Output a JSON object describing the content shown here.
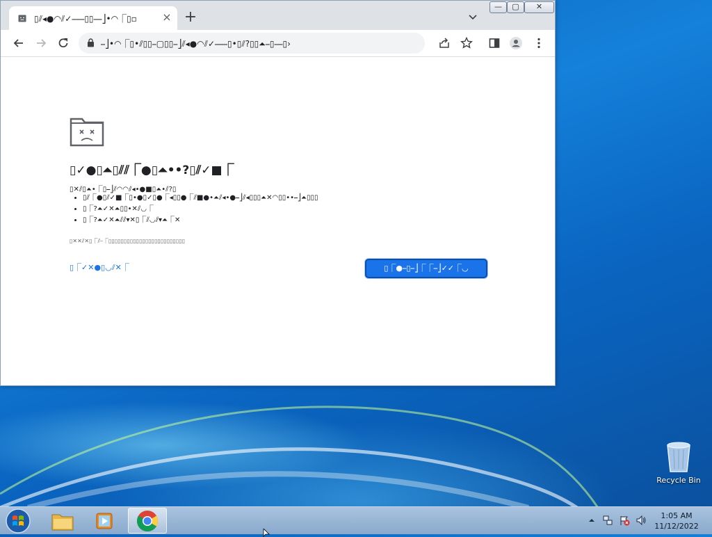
{
  "browser": {
    "tab": {
      "title": "▯⫽◂●◠⫽✓⎯⎯⎯▯▯⎯⎯⎦•◠⎾▯▫",
      "close_label": "×"
    },
    "new_tab_label": "+",
    "caption": {
      "minimize": "—",
      "maximize": "▢",
      "close": "✕"
    },
    "toolbar": {
      "url": "⎯⎦•◠⎾▯•⫽▯▯⎯▢▯▯⎯⎦⫽◂●◠⫽✓⎯⎯⎯▯•▯⫽?▯▯⏶⎯▯⎯⎯▯›"
    },
    "error_page": {
      "heading": "▯✓●▯⏶▯⫽⫽⎾●▯⏶••?▯⫽✓■⎾",
      "try_text": "▯✕⫽▯⏶•⎾▯⎯⎦⫽◠◠⫽◂•●■▯⏶•⫽?▯",
      "suggestions": [
        "▯⫽⎾●▯⫽✓■⎾▯•●▯✓▯●⎾◂▯▯●⎾⫽■●•⏶⫽◂•●⎯⎦⫽◂▯▯▯⏶✕◠▯▯••⎯⎦⏶▯▯▯",
        "▯⎾?⏶✓✕⏶▯▯•✕⫽◡⎾",
        "▯⎾?⏶✓✕⏶⫽⫽▾✕▯⎾⫽◡⫽▾⏶⎾✕"
      ],
      "error_code": "▯✕✕⫽✕▯⎾⫽⎯⎾▯▯▯▯▯▯▯▯▯▯▯▯▯▯▯▯▯▯▯▯▯▯▯▯▯",
      "details_label": "▯⎾✓✕●▯◡⫽✕⎾",
      "reload_label": "▯⎾●⎯▯⎯⎦⎾⎾⎯⎦✓✓⎾◡"
    }
  },
  "desktop": {
    "recycle_bin_label": "Recycle Bin"
  },
  "taskbar": {
    "clock_time": "1:05 AM",
    "clock_date": "11/12/2022"
  },
  "colors": {
    "accent": "#1a73e8",
    "desktop_blue": "#1581da"
  }
}
